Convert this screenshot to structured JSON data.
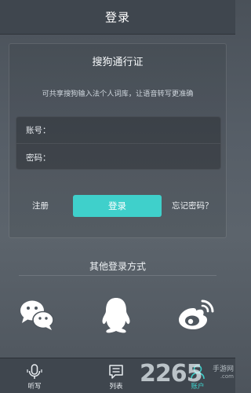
{
  "header": {
    "title": "登录"
  },
  "login_card": {
    "title": "搜狗通行证",
    "description": "可共享搜狗输入法个人词库，让语音转写更准确",
    "fields": {
      "account_label": "账号：",
      "account_value": "",
      "password_label": "密码：",
      "password_value": ""
    },
    "register_label": "注册",
    "login_button": "登录",
    "forgot_label": "忘记密码？"
  },
  "other_login": {
    "label": "其他登录方式",
    "methods": [
      "wechat-icon",
      "qq-icon",
      "weibo-icon"
    ]
  },
  "bottom_nav": {
    "tabs": [
      {
        "label": "听写",
        "icon": "microphone-icon",
        "active": false
      },
      {
        "label": "列表",
        "icon": "list-icon",
        "active": false
      },
      {
        "label": "账户",
        "icon": "account-icon",
        "active": true
      }
    ]
  },
  "colors": {
    "accent": "#3fd0cb",
    "header_bg": "#3f464e",
    "bottom_bar_bg": "#3f464e"
  },
  "watermark": {
    "number": "2265",
    "site_name": "手游网",
    "url": ".com"
  }
}
